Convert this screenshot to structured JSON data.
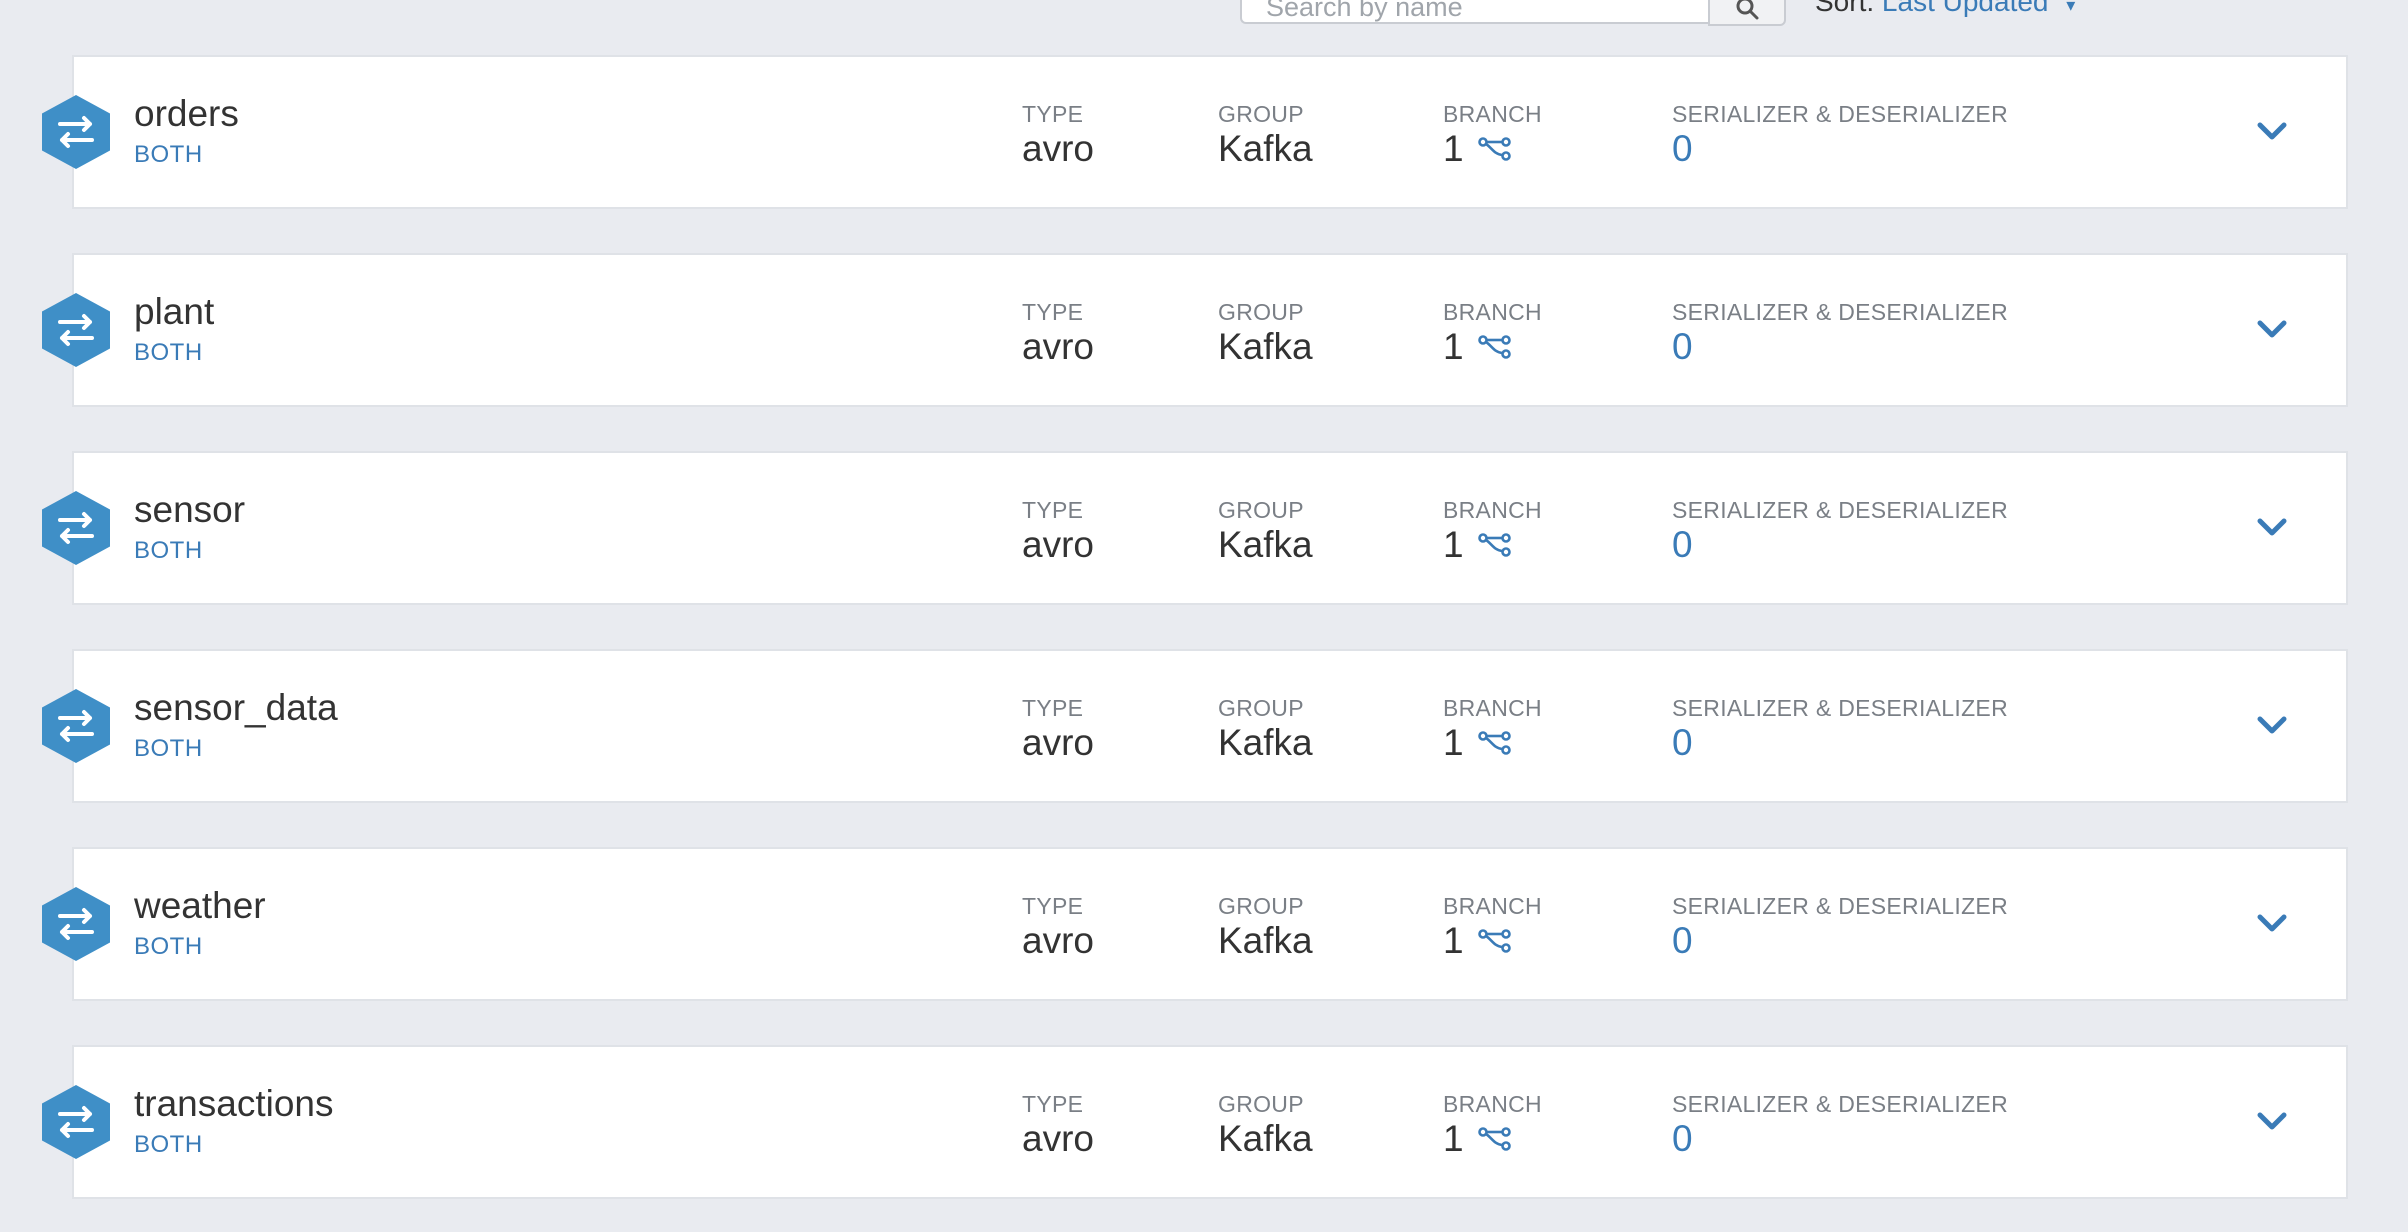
{
  "search": {
    "placeholder": "Search by name"
  },
  "sort": {
    "label": "Sort:",
    "value": "Last Updated"
  },
  "columns": {
    "type_label": "TYPE",
    "group_label": "GROUP",
    "branch_label": "BRANCH",
    "serde_label": "SERIALIZER & DESERIALIZER"
  },
  "schemas": [
    {
      "name": "orders",
      "badge": "BOTH",
      "type": "avro",
      "group": "Kafka",
      "branch": "1",
      "serde": "0"
    },
    {
      "name": "plant",
      "badge": "BOTH",
      "type": "avro",
      "group": "Kafka",
      "branch": "1",
      "serde": "0"
    },
    {
      "name": "sensor",
      "badge": "BOTH",
      "type": "avro",
      "group": "Kafka",
      "branch": "1",
      "serde": "0"
    },
    {
      "name": "sensor_data",
      "badge": "BOTH",
      "type": "avro",
      "group": "Kafka",
      "branch": "1",
      "serde": "0"
    },
    {
      "name": "weather",
      "badge": "BOTH",
      "type": "avro",
      "group": "Kafka",
      "branch": "1",
      "serde": "0"
    },
    {
      "name": "transactions",
      "badge": "BOTH",
      "type": "avro",
      "group": "Kafka",
      "branch": "1",
      "serde": "0"
    }
  ],
  "icons": {
    "schema": "swap-arrows-icon",
    "branch": "branch-icon",
    "expand": "chevron-down-icon",
    "search": "search-icon"
  },
  "colors": {
    "accent": "#3a7bb7",
    "hexagon": "#3f8fc7",
    "background": "#e9ebf0"
  }
}
